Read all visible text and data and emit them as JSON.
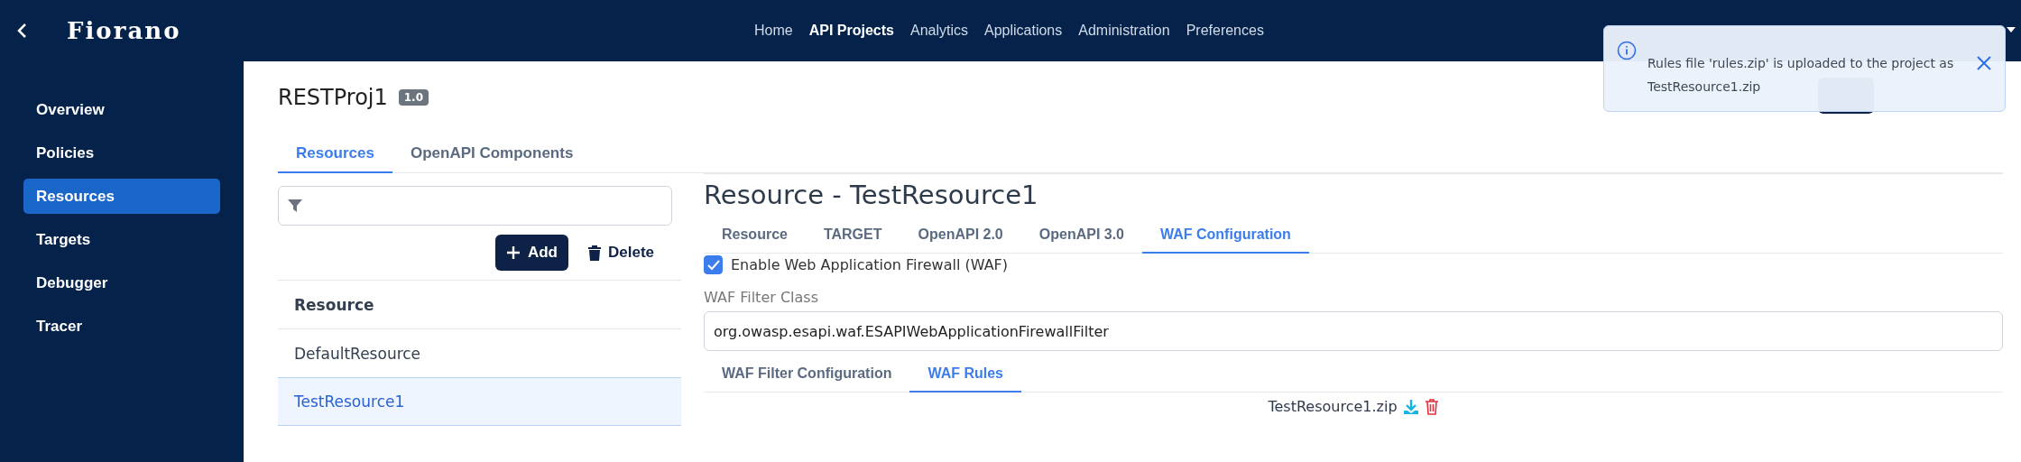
{
  "header": {
    "logo": "Fiorano",
    "nav": [
      {
        "label": "Home",
        "selected": false
      },
      {
        "label": "API Projects",
        "selected": true
      },
      {
        "label": "Analytics",
        "selected": false
      },
      {
        "label": "Applications",
        "selected": false
      },
      {
        "label": "Administration",
        "selected": false
      },
      {
        "label": "Preferences",
        "selected": false
      }
    ]
  },
  "sidebar": {
    "items": [
      {
        "label": "Overview",
        "selected": false
      },
      {
        "label": "Policies",
        "selected": false
      },
      {
        "label": "Resources",
        "selected": true
      },
      {
        "label": "Targets",
        "selected": false
      },
      {
        "label": "Debugger",
        "selected": false
      },
      {
        "label": "Tracer",
        "selected": false
      }
    ]
  },
  "project": {
    "name": "RESTProj1",
    "version": "1.0"
  },
  "tabs": [
    {
      "label": "Resources",
      "selected": true
    },
    {
      "label": "OpenAPI Components",
      "selected": false
    }
  ],
  "resources": {
    "add_label": "Add",
    "delete_label": "Delete",
    "column": "Resource",
    "rows": [
      {
        "name": "DefaultResource",
        "selected": false
      },
      {
        "name": "TestResource1",
        "selected": true
      }
    ]
  },
  "detail": {
    "title": "Resource - TestResource1",
    "tabs": [
      {
        "label": "Resource",
        "selected": false
      },
      {
        "label": "TARGET",
        "selected": false
      },
      {
        "label": "OpenAPI 2.0",
        "selected": false
      },
      {
        "label": "OpenAPI 3.0",
        "selected": false
      },
      {
        "label": "WAF Configuration",
        "selected": true
      }
    ],
    "waf_enabled": {
      "label": "Enable Web Application Firewall (WAF)",
      "checked": true
    },
    "filter_class": {
      "label": "WAF Filter Class",
      "value": "org.owasp.esapi.waf.ESAPIWebApplicationFirewallFilter"
    },
    "sub_tabs": [
      {
        "label": "WAF Filter Configuration",
        "selected": false
      },
      {
        "label": "WAF Rules",
        "selected": true
      }
    ],
    "rules_file": "TestResource1.zip"
  },
  "toast": {
    "message": "Rules file 'rules.zip' is uploaded to the project as TestResource1.zip"
  }
}
